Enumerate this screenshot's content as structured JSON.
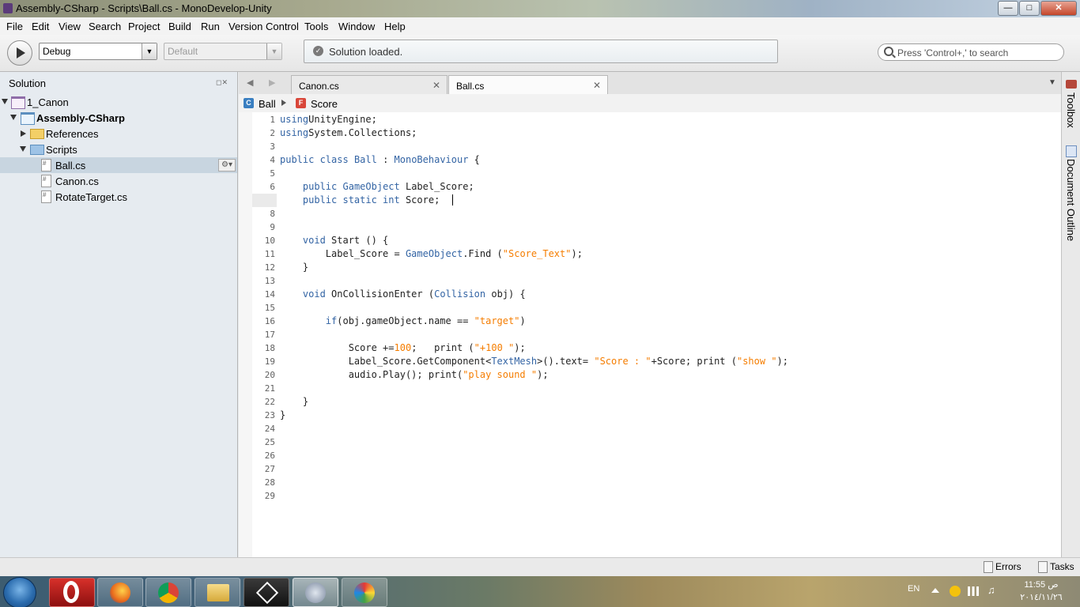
{
  "window": {
    "title": "Assembly-CSharp - Scripts\\Ball.cs - MonoDevelop-Unity"
  },
  "menu": [
    "File",
    "Edit",
    "View",
    "Search",
    "Project",
    "Build",
    "Run",
    "Version Control",
    "Tools",
    "Window",
    "Help"
  ],
  "toolbar": {
    "configuration": "Debug",
    "platform": "Default",
    "status": "Solution loaded.",
    "search_placeholder": "Press 'Control+,' to search"
  },
  "solution": {
    "title": "Solution",
    "solution_name": "1_Canon",
    "project_name": "Assembly-CSharp",
    "references": "References",
    "scripts_folder": "Scripts",
    "files": [
      "Ball.cs",
      "Canon.cs",
      "RotateTarget.cs"
    ]
  },
  "tabs": [
    "Canon.cs",
    "Ball.cs"
  ],
  "breadcrumb": {
    "class_name": "Ball",
    "member_name": "Score"
  },
  "code": {
    "lines": [
      [
        [
          "kw",
          "using"
        ],
        [
          "",
          "UnityEngine;"
        ]
      ],
      [
        [
          "kw",
          "using"
        ],
        [
          "",
          "System.Collections;"
        ]
      ],
      [],
      [
        [
          "kw",
          "public class"
        ],
        [
          "",
          " "
        ],
        [
          "ty",
          "Ball"
        ],
        [
          "",
          " : "
        ],
        [
          "ty",
          "MonoBehaviour"
        ],
        [
          "",
          " {"
        ]
      ],
      [],
      [
        [
          "",
          "    "
        ],
        [
          "kw",
          "public"
        ],
        [
          "",
          " "
        ],
        [
          "ty",
          "GameObject"
        ],
        [
          "",
          " Label_Score;"
        ]
      ],
      [
        [
          "",
          "    "
        ],
        [
          "kw",
          "public static int"
        ],
        [
          "",
          " Score;"
        ]
      ],
      [],
      [],
      [
        [
          "",
          "    "
        ],
        [
          "kw",
          "void"
        ],
        [
          "",
          " Start () {"
        ]
      ],
      [
        [
          "",
          "        Label_Score = "
        ],
        [
          "ty",
          "GameObject"
        ],
        [
          "",
          ".Find ("
        ],
        [
          "str",
          "\"Score_Text\""
        ],
        [
          "",
          ");"
        ]
      ],
      [
        [
          "",
          "    }"
        ]
      ],
      [],
      [
        [
          "",
          "    "
        ],
        [
          "kw",
          "void"
        ],
        [
          "",
          " OnCollisionEnter ("
        ],
        [
          "ty",
          "Collision"
        ],
        [
          "",
          " obj) {"
        ]
      ],
      [],
      [
        [
          "",
          "        "
        ],
        [
          "kw",
          "if"
        ],
        [
          "",
          "(obj.gameObject.name == "
        ],
        [
          "str",
          "\"target\""
        ],
        [
          "",
          ")"
        ]
      ],
      [],
      [
        [
          "",
          "            Score +="
        ],
        [
          "num",
          "100"
        ],
        [
          "",
          ";   print ("
        ],
        [
          "str",
          "\"+100 \""
        ],
        [
          "",
          ");"
        ]
      ],
      [
        [
          "",
          "            Label_Score.GetComponent<"
        ],
        [
          "ty",
          "TextMesh"
        ],
        [
          "",
          ">().text= "
        ],
        [
          "str",
          "\"Score : \""
        ],
        [
          "",
          "+Score; print ("
        ],
        [
          "str",
          "\"show \""
        ],
        [
          "",
          ");"
        ]
      ],
      [
        [
          "",
          "            audio.Play(); print("
        ],
        [
          "str",
          "\"play sound \""
        ],
        [
          "",
          ");"
        ]
      ],
      [],
      [
        [
          "",
          "    }"
        ]
      ],
      [
        [
          "",
          "}"
        ]
      ],
      [],
      [],
      [],
      [],
      [],
      []
    ],
    "line_numbers": [
      "1",
      "2",
      "3",
      "4",
      "5",
      "6",
      "7",
      "8",
      "9",
      "10",
      "11",
      "12",
      "13",
      "14",
      "15",
      "16",
      "17",
      "18",
      "19",
      "20",
      "21",
      "22",
      "23",
      "24",
      "25",
      "26",
      "27",
      "28",
      "29"
    ],
    "current_line": 7
  },
  "right_dock": {
    "toolbox": "Toolbox",
    "outline": "Document Outline"
  },
  "statusbar": {
    "errors": "Errors",
    "tasks": "Tasks"
  },
  "taskbar": {
    "language": "EN",
    "time": "11:55 ص",
    "date": "٢٠١٤/١١/٢٦"
  },
  "colors": {
    "keyword": "#3364a4",
    "string": "#f57d00",
    "selected_row": "#c8d5e0"
  }
}
